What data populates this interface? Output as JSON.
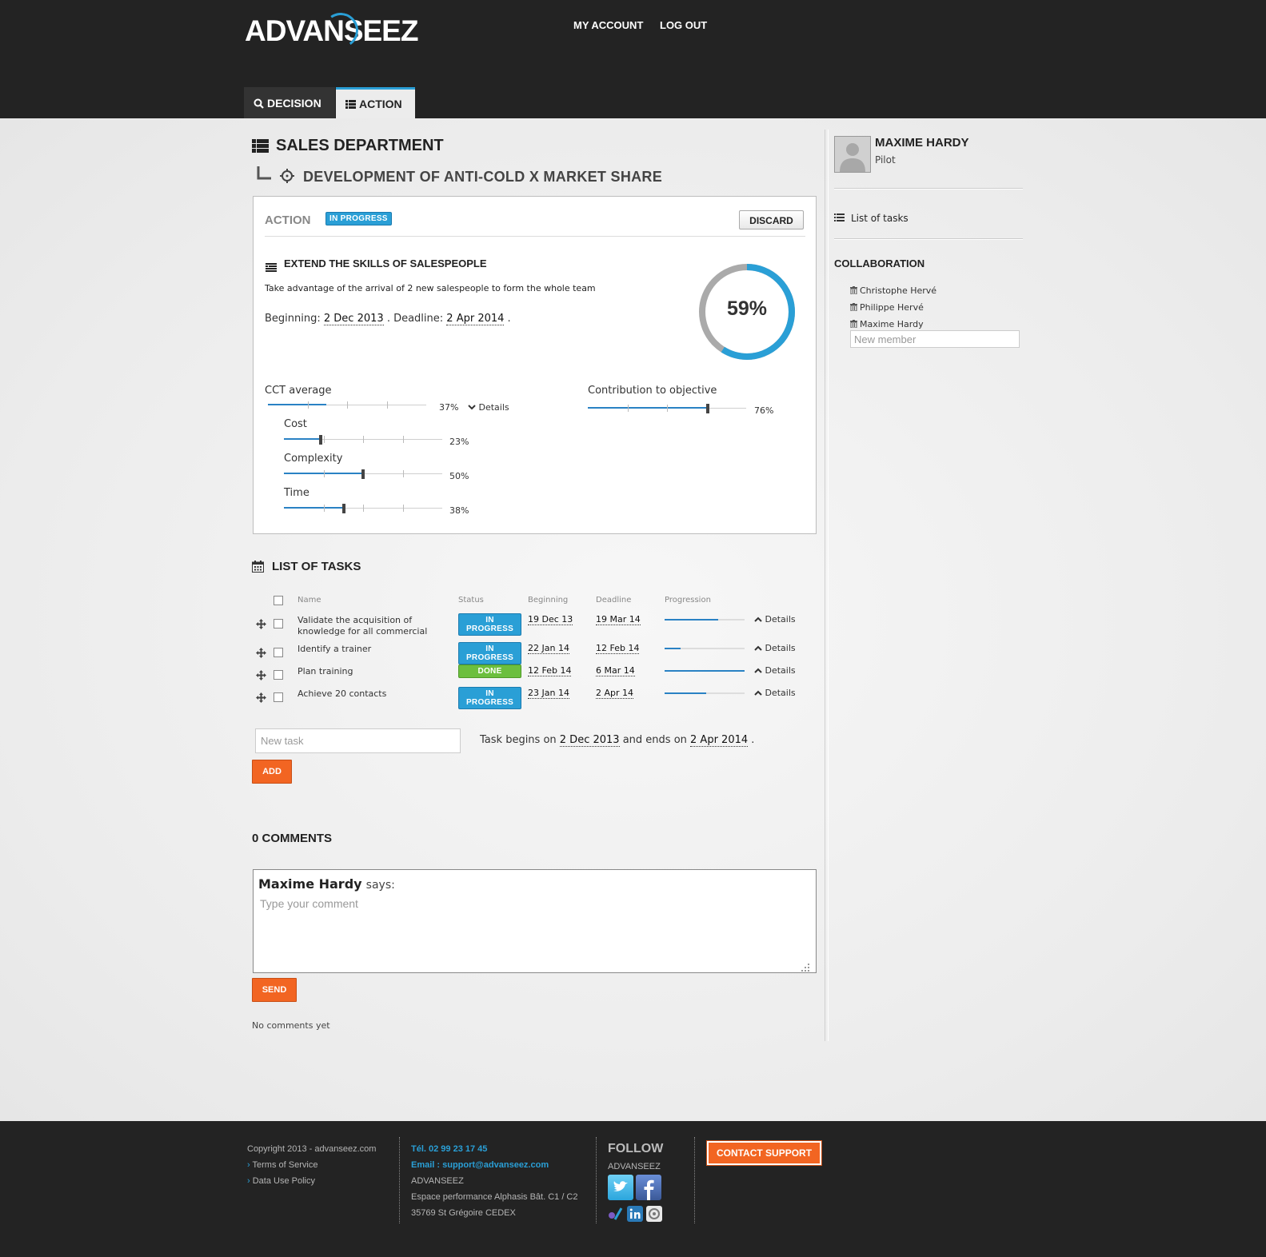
{
  "header": {
    "logo": "ADVANSEEZ",
    "nav": {
      "my_account": "MY ACCOUNT",
      "log_out": "LOG OUT"
    },
    "tabs": [
      {
        "label": "DECISION",
        "icon": "search-icon",
        "active": false
      },
      {
        "label": "ACTION",
        "icon": "list-icon",
        "active": true
      }
    ]
  },
  "breadcrumb": {
    "department": "SALES DEPARTMENT",
    "objective": "DEVELOPMENT OF ANTI-COLD X MARKET SHARE"
  },
  "action_card": {
    "heading": "ACTION",
    "status": "IN PROGRESS",
    "discard_label": "DISCARD",
    "title": "EXTEND THE SKILLS OF SALESPEOPLE",
    "description": "Take advantage of the arrival of 2 new salespeople to form the whole team",
    "beginning_label": "Beginning:",
    "beginning": "2 Dec 2013",
    "deadline_label": ". Deadline:",
    "deadline": "2 Apr 2014",
    "deadline_end": ".",
    "progress_value": 0.59,
    "progress_text": "59%",
    "cct": {
      "label": "CCT average",
      "value": 0.37,
      "value_text": "37%",
      "details_label": "Details",
      "sub": [
        {
          "label": "Cost",
          "value": 0.23,
          "value_text": "23%"
        },
        {
          "label": "Complexity",
          "value": 0.5,
          "value_text": "50%"
        },
        {
          "label": "Time",
          "value": 0.38,
          "value_text": "38%"
        }
      ]
    },
    "contribution": {
      "label": "Contribution to objective",
      "value": 0.76,
      "value_text": "76%"
    }
  },
  "tasks": {
    "heading": "LIST OF TASKS",
    "columns": {
      "name": "Name",
      "status": "Status",
      "beginning": "Beginning",
      "deadline": "Deadline",
      "progression": "Progression"
    },
    "details_label": "Details",
    "rows": [
      {
        "name": "Validate the acquisition of knowledge for all commercial",
        "status": "IN PROGRESS",
        "done": false,
        "beginning": "19 Dec 13",
        "deadline": "19 Mar 14",
        "progress": 0.67
      },
      {
        "name": "Identify a trainer",
        "status": "IN PROGRESS",
        "done": false,
        "beginning": "22 Jan 14",
        "deadline": "12 Feb 14",
        "progress": 0.2
      },
      {
        "name": "Plan training",
        "status": "DONE",
        "done": true,
        "beginning": "12 Feb 14",
        "deadline": "6 Mar 14",
        "progress": 1.0
      },
      {
        "name": "Achieve 20 contacts",
        "status": "IN PROGRESS",
        "done": false,
        "beginning": "23 Jan 14",
        "deadline": "2 Apr 14",
        "progress": 0.52
      }
    ],
    "new_task_placeholder": "New task",
    "begins_label": "Task begins on",
    "begins": "2 Dec 2013",
    "ends_label": "and ends on",
    "ends": "2 Apr 2014",
    "ends_end": ".",
    "add_label": "ADD"
  },
  "comments": {
    "heading": "0 COMMENTS",
    "author": "Maxime Hardy",
    "says": "says:",
    "placeholder": "Type your comment",
    "send_label": "SEND",
    "empty_text": "No comments yet"
  },
  "sidebar": {
    "user_name": "MAXIME HARDY",
    "user_role": "Pilot",
    "list_of_tasks": "List of tasks",
    "collaboration_heading": "COLLABORATION",
    "members": [
      "Christophe Hervé",
      "Philippe Hervé",
      "Maxime Hardy"
    ],
    "new_member_placeholder": "New member"
  },
  "footer": {
    "copyright": "Copyright 2013 - advanseez.com",
    "terms": "Terms of Service",
    "data_policy": "Data Use Policy",
    "tel": "Tél. 02 99 23 17 45",
    "email": "Email : support@advanseez.com",
    "company": "ADVANSEEZ",
    "address1": "Espace performance Alphasis Bât. C1 / C2",
    "address2": "35769 St Grégoire CEDEX",
    "follow": "FOLLOW",
    "follow_sub": "ADVANSEEZ",
    "contact_support": "CONTACT SUPPORT"
  },
  "colors": {
    "accent": "#2a9fd6",
    "orange": "#f26522",
    "done": "#6cbf3e",
    "header_bg": "#232323"
  }
}
